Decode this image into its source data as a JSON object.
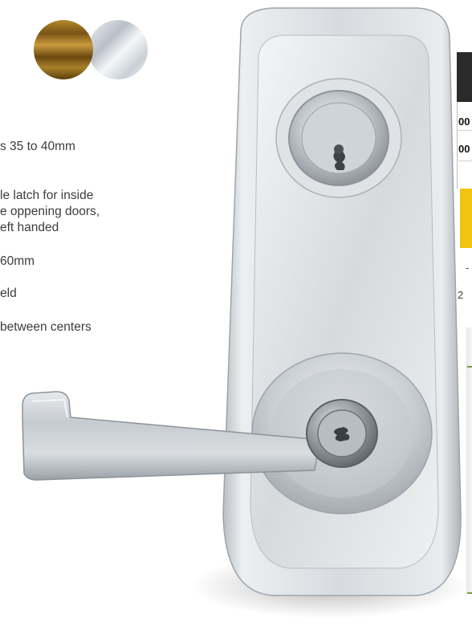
{
  "finishes": [
    {
      "name": "brass-finish",
      "color": "#9a6f22"
    },
    {
      "name": "satin-chrome-finish",
      "color": "#d3d9df"
    }
  ],
  "specs": [
    "s 35 to 40mm",
    "le latch for inside",
    "e oppening doors,",
    "eft handed",
    "60mm",
    "eld",
    "between centers"
  ],
  "table": {
    "codes": [
      "00",
      "00"
    ],
    "row_a": "-",
    "row_b": "2"
  },
  "colors": {
    "header": "#2a2a2a",
    "highlight": "#f1c40f",
    "accent_line": "#7a9a3a"
  }
}
